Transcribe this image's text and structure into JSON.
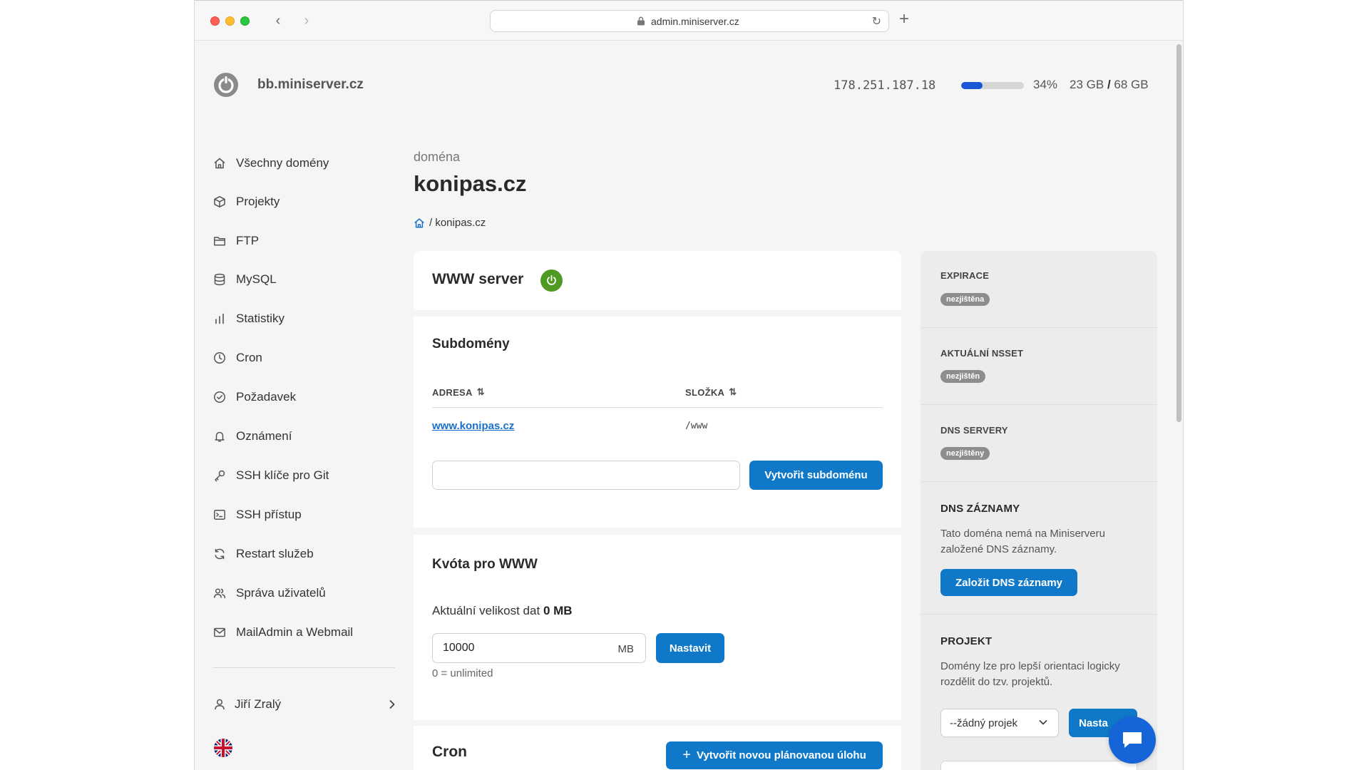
{
  "browser": {
    "url": "admin.miniserver.cz"
  },
  "header": {
    "site_name": "bb.miniserver.cz",
    "ip": "178.251.187.18",
    "disk_usage_fraction": 0.34,
    "disk_percent": "34%",
    "disk_used": "23 GB",
    "disk_separator": "/",
    "disk_total": "68 GB"
  },
  "sidebar": {
    "items": [
      {
        "label": "Všechny domény",
        "icon": "home-icon"
      },
      {
        "label": "Projekty",
        "icon": "cube-icon"
      },
      {
        "label": "FTP",
        "icon": "folder-icon"
      },
      {
        "label": "MySQL",
        "icon": "database-icon"
      },
      {
        "label": "Statistiky",
        "icon": "bar-chart-icon"
      },
      {
        "label": "Cron",
        "icon": "clock-icon"
      },
      {
        "label": "Požadavek",
        "icon": "check-circle-icon"
      },
      {
        "label": "Oznámení",
        "icon": "bell-icon"
      },
      {
        "label": "SSH klíče pro Git",
        "icon": "key-icon"
      },
      {
        "label": "SSH přístup",
        "icon": "terminal-icon"
      },
      {
        "label": "Restart služeb",
        "icon": "refresh-icon"
      },
      {
        "label": "Správa uživatelů",
        "icon": "users-icon"
      },
      {
        "label": "MailAdmin a Webmail",
        "icon": "mail-icon"
      }
    ],
    "user_name": "Jiří Zralý"
  },
  "main": {
    "kicker": "doména",
    "domain": "konipas.cz",
    "breadcrumb_sep": "/",
    "breadcrumb_current": "konipas.cz",
    "www_server": {
      "title": "WWW server",
      "status_color": "#4e9a23"
    },
    "subdomains": {
      "title": "Subdomény",
      "col_address": "ADRESA",
      "col_folder": "SLOŽKA",
      "rows": [
        {
          "address": "www.konipas.cz",
          "folder": "/www"
        }
      ],
      "input_value": "",
      "create_button": "Vytvořit subdoménu"
    },
    "quota": {
      "title": "Kvóta pro WWW",
      "current_label": "Aktuální velikost dat",
      "current_value": "0 MB",
      "input_value": "10000",
      "unit": "MB",
      "set_button": "Nastavit",
      "hint": "0 = unlimited"
    },
    "cron": {
      "title": "Cron",
      "create_button": "Vytvořit novou plánovanou úlohu"
    }
  },
  "right_panel": {
    "expiration_label": "EXPIRACE",
    "expiration_value": "nezjištěna",
    "nsset_label": "AKTUÁLNÍ NSSET",
    "nsset_value": "nezjištěn",
    "dns_servers_label": "DNS SERVERY",
    "dns_servers_value": "nezjištěny",
    "dns_records_title": "DNS ZÁZNAMY",
    "dns_records_text": "Tato doména nemá na Miniserveru založené DNS záznamy.",
    "dns_records_button": "Založit DNS záznamy",
    "project_title": "PROJEKT",
    "project_text": "Domény lze pro lepší orientaci logicky rozdělit do tzv. projektů.",
    "project_select": "--žádný projek",
    "project_button": "Nasta"
  },
  "colors": {
    "accent": "#0f78c8",
    "disk_bar": "#1a56d6",
    "chat": "#1565d8"
  }
}
